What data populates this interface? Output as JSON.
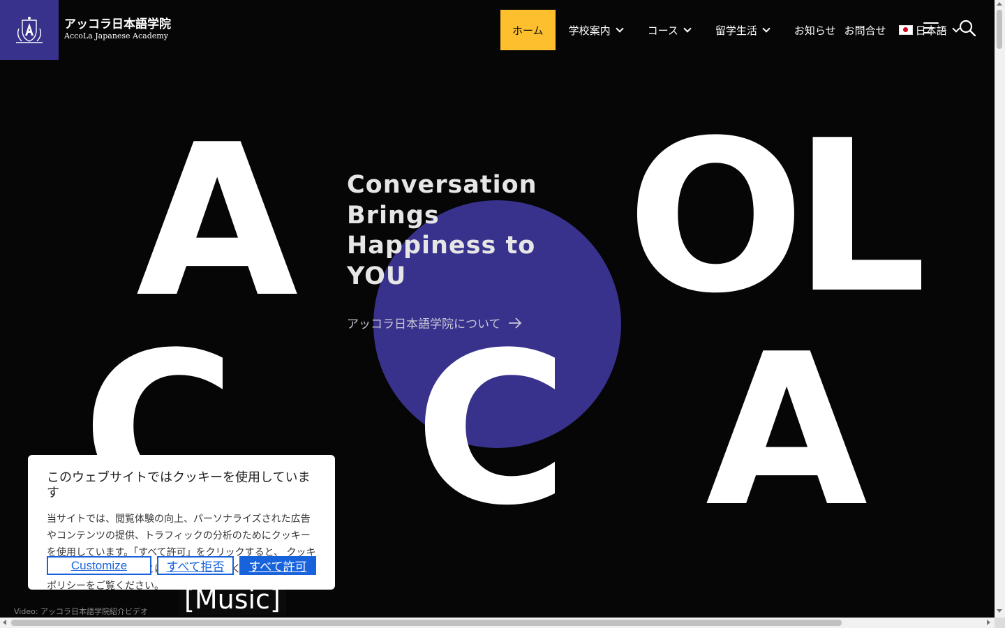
{
  "brand": {
    "name_jp": "アッコラ日本語学院",
    "name_en": "AccoLa Japanese Academy"
  },
  "nav": {
    "items": [
      "ホーム",
      "学校案内",
      "コース",
      "留学生活",
      "お知らせ",
      "お問合せ",
      "日本語"
    ],
    "active": "ホーム"
  },
  "hero": {
    "letters": [
      "A",
      "OL",
      "C",
      "C",
      "A"
    ],
    "headline": "Conversation Brings Happiness to YOU",
    "link_label": "アッコラ日本語学院について"
  },
  "video": {
    "caption": "[Music]",
    "credit": "Video: アッコラ日本語学院紹介ビデオ"
  },
  "cookie": {
    "title": "このウェブサイトではクッキーを使用しています",
    "text": "当サイトでは、閲覧体験の向上、パーソナライズされた広告やコンテンツの提供、トラフィックの分析のためにクッキーを使用しています。「すべて許可」をクリックすると、 クッキーの使用に同意したことになります。詳しくはプライバシーポリシーをご覧ください。",
    "buttons": {
      "customize": "Customize",
      "reject": "すべて拒否",
      "accept": "すべて許可"
    }
  },
  "colors": {
    "brand_indigo": "#38328c",
    "nav_active": "#fdbf2d",
    "cookie_button": "#1863dc",
    "background": "#060606"
  },
  "icons": [
    "hamburger-menu-icon",
    "search-icon",
    "chevron-down-icon",
    "arrow-right-icon",
    "japan-flag-icon",
    "crest-logo"
  ]
}
